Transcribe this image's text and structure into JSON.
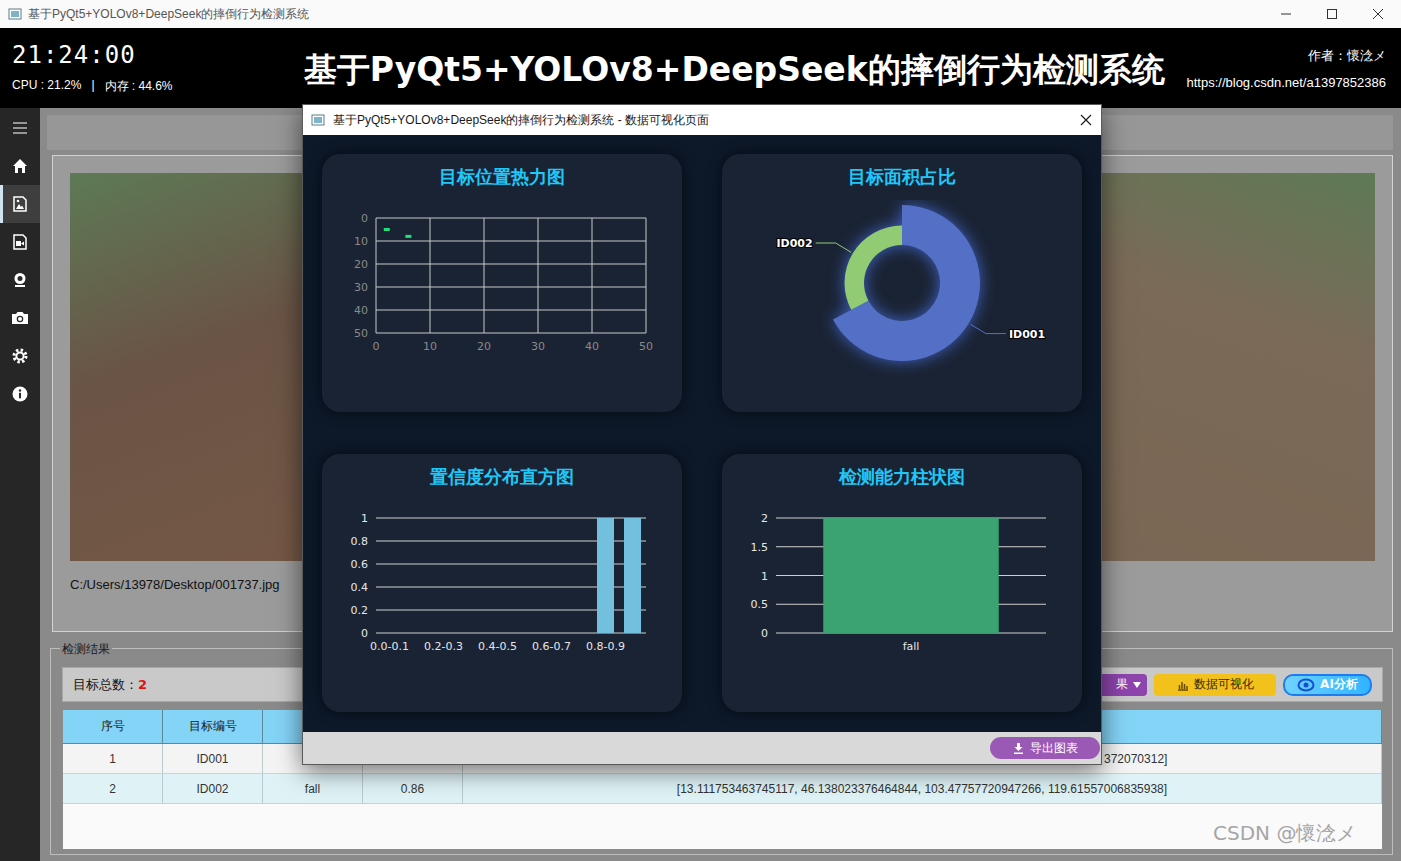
{
  "window": {
    "title": "基于PyQt5+YOLOv8+DeepSeek的摔倒行为检测系统"
  },
  "header": {
    "clock": "21:24:00",
    "cpu": "CPU : 21.2%",
    "separator": "|",
    "memory": "内存 : 44.6%",
    "title": "基于PyQt5+YOLOv8+DeepSeek的摔倒行为检测系统",
    "author": "作者：懷淰メ",
    "link": "https://blog.csdn.net/a1397852386"
  },
  "sidebar": {
    "items": [
      {
        "selected": false
      },
      {
        "selected": false
      },
      {
        "selected": true
      },
      {
        "selected": false
      },
      {
        "selected": false
      },
      {
        "selected": false
      },
      {
        "selected": false
      },
      {
        "selected": false
      }
    ]
  },
  "image_panel": {
    "path": "C:/Users/13978/Desktop/001737.jpg"
  },
  "results": {
    "title": "检测结果",
    "count_label": "目标总数：",
    "count": "2",
    "buttons": [
      {
        "label": "果",
        "kind": "dropdown"
      },
      {
        "label": "数据可视化",
        "kind": "chart"
      },
      {
        "label": "AI分析",
        "kind": "ai"
      }
    ]
  },
  "table": {
    "columns": [
      "序号",
      "目标编号",
      "",
      "",
      ""
    ],
    "rows": [
      {
        "cells": [
          "1",
          "ID001",
          "",
          "",
          "372070312]"
        ],
        "cut": true
      },
      {
        "cells": [
          "2",
          "ID002",
          "fall",
          "0.86",
          "[13.111753463745117, 46.138023376464844, 103.47757720947266, 119.61557006835938]"
        ],
        "cut": false
      }
    ]
  },
  "dialog": {
    "title": "基于PyQt5+YOLOv8+DeepSeek的摔倒行为检测系统 - 数据可视化页面",
    "export_button": "导出图表",
    "charts": {
      "heatmap": {
        "title": "目标位置热力图",
        "x_ticks": [
          "0",
          "10",
          "20",
          "30",
          "40",
          "50"
        ],
        "y_ticks": [
          "0",
          "10",
          "20",
          "30",
          "40",
          "50"
        ],
        "max": 50,
        "points": [
          [
            2,
            5
          ],
          [
            6,
            8
          ]
        ]
      },
      "area_pie": {
        "title": "目标面积占比",
        "slices": [
          {
            "name": "ID001",
            "value": 13500,
            "color": "#5470c6"
          },
          {
            "name": "ID002",
            "value": 6570,
            "color": "#91cc75"
          }
        ]
      },
      "confidence_hist": {
        "title": "置信度分布直方图",
        "y_ticks": [
          "0",
          "0.2",
          "0.4",
          "0.6",
          "0.8",
          "1"
        ],
        "x_labels": [
          "0.0-0.1",
          "0.2-0.3",
          "0.4-0.5",
          "0.6-0.7",
          "0.8-0.9"
        ],
        "max": 1,
        "values": [
          0,
          0,
          0,
          0,
          0,
          0,
          0,
          0,
          1,
          1
        ]
      },
      "class_bar": {
        "title": "检测能力柱状图",
        "y_ticks": [
          "0",
          "0.5",
          "1",
          "1.5",
          "2"
        ],
        "max": 2,
        "bars": [
          {
            "label": "fall",
            "value": 2
          }
        ]
      }
    }
  },
  "watermark": "CSDN @懷淰メ"
}
